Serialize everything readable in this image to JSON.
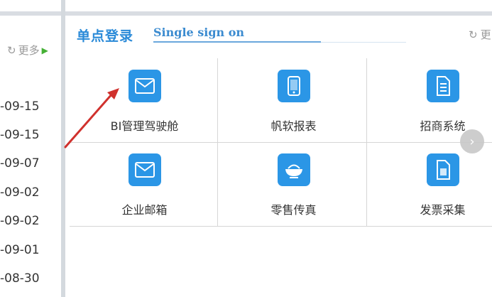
{
  "left_panel": {
    "more_label": "更多",
    "dates": [
      "-09-15",
      "-09-15",
      "-09-07",
      "-09-02",
      "-09-02",
      "-09-01",
      "-08-30"
    ]
  },
  "sso": {
    "title_cn": "单点登录",
    "title_en": "Single sign on",
    "more_label": "更",
    "items": [
      {
        "label": "BI管理驾驶舱",
        "icon": "envelope-icon"
      },
      {
        "label": "帆软报表",
        "icon": "tablet-icon"
      },
      {
        "label": "招商系统",
        "icon": "document-icon"
      },
      {
        "label": "企业邮箱",
        "icon": "envelope-icon"
      },
      {
        "label": "零售传真",
        "icon": "bowl-icon"
      },
      {
        "label": "发票采集",
        "icon": "document-icon"
      }
    ]
  },
  "colors": {
    "accent": "#2a8ad8",
    "icon_bg": "#2b96e6",
    "annotation_arrow": "#d0312d",
    "more_arrow": "#45b035"
  }
}
